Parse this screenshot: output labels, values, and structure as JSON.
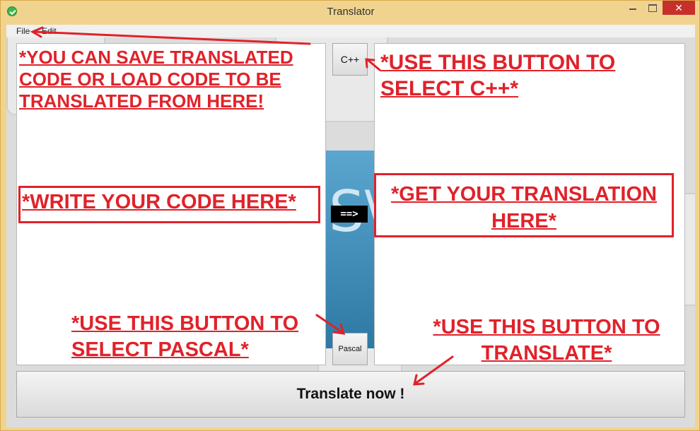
{
  "window": {
    "title": "Translator",
    "close_glyph": "✕"
  },
  "menu": {
    "items": [
      "File",
      "Edit"
    ]
  },
  "buttons": {
    "cpp": "C++",
    "pascal": "Pascal",
    "translate": "Translate now !"
  },
  "arrow_label": "==>",
  "annotations": {
    "file_note": [
      "*YOU CAN SAVE TRANSLATED ",
      "CODE OR LOAD CODE TO BE ",
      "TRANSLATED FROM HERE!"
    ],
    "write_code": "*WRITE YOUR CODE HERE*",
    "cpp_note": [
      "*USE THIS BUTTON TO ",
      "SELECT C++*"
    ],
    "translation_note": [
      "*GET YOUR TRANSLATION ",
      "HERE*"
    ],
    "pascal_note": [
      "*USE THIS BUTTON TO ",
      "SELECT PASCAL*"
    ],
    "translate_note": [
      "*USE THIS BUTTON TO ",
      "TRANSLATE*"
    ]
  },
  "colors": {
    "annotation": "#e0222a",
    "window_frame": "#f0d38e",
    "close_button": "#c7302a"
  },
  "icons": [
    "app-icon",
    "minimize-icon",
    "maximize-icon",
    "close-icon"
  ]
}
